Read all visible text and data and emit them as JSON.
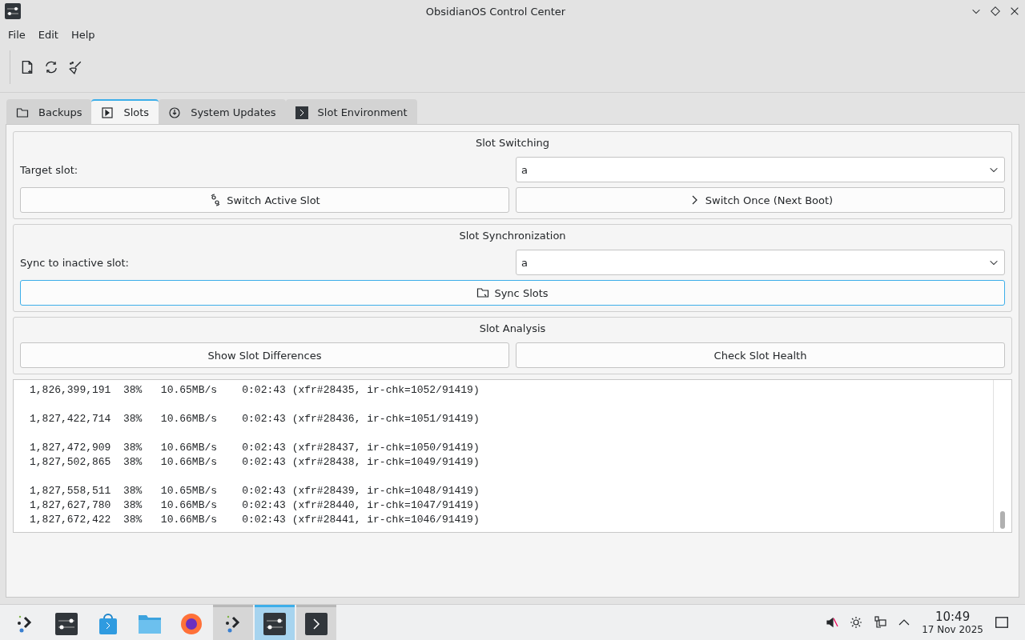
{
  "window": {
    "title": "ObsidianOS Control Center"
  },
  "menu": [
    "File",
    "Edit",
    "Help"
  ],
  "toolbar": [
    {
      "kind": "new"
    },
    {
      "kind": "refresh"
    },
    {
      "kind": "clean"
    }
  ],
  "tabs": [
    {
      "label": "Backups",
      "kind": "folder",
      "selected": false
    },
    {
      "label": "Slots",
      "kind": "play",
      "selected": true
    },
    {
      "label": "System Updates",
      "kind": "update",
      "selected": false
    },
    {
      "label": "Slot Environment",
      "kind": "terminal",
      "selected": false
    }
  ],
  "groups": [
    {
      "title": "Slot Switching",
      "field": {
        "label": "Target slot:",
        "value": "a"
      },
      "buttons": [
        {
          "label": "Switch Active Slot",
          "kind": "swap",
          "focused": false
        },
        {
          "label": "Switch Once (Next Boot)",
          "kind": "chevron",
          "focused": false
        }
      ]
    },
    {
      "title": "Slot Synchronization",
      "field": {
        "label": "Sync to inactive slot:",
        "value": "a"
      },
      "buttons": [
        {
          "label": "Sync Slots",
          "kind": "folder",
          "focused": true
        }
      ]
    },
    {
      "title": "Slot Analysis",
      "buttons": [
        {
          "label": "Show Slot Differences",
          "kind": "plain",
          "focused": false
        },
        {
          "label": "Check Slot Health",
          "kind": "plain",
          "focused": false
        }
      ]
    }
  ],
  "log": [
    {
      "lines": [
        "1,826,399,191  38%   10.65MB/s    0:02:43 (xfr#28435, ir-chk=1052/91419)"
      ]
    },
    {
      "lines": [
        "1,827,422,714  38%   10.66MB/s    0:02:43 (xfr#28436, ir-chk=1051/91419)"
      ]
    },
    {
      "lines": [
        "1,827,472,909  38%   10.66MB/s    0:02:43 (xfr#28437, ir-chk=1050/91419)",
        "1,827,502,865  38%   10.66MB/s    0:02:43 (xfr#28438, ir-chk=1049/91419)"
      ]
    },
    {
      "lines": [
        "1,827,558,511  38%   10.65MB/s    0:02:43 (xfr#28439, ir-chk=1048/91419)",
        "1,827,627,780  38%   10.66MB/s    0:02:43 (xfr#28440, ir-chk=1047/91419)",
        "1,827,672,422  38%   10.66MB/s    0:02:43 (xfr#28441, ir-chk=1046/91419)"
      ]
    }
  ],
  "taskbar": [
    {
      "kind": "launcher",
      "running": false,
      "selected": false
    },
    {
      "kind": "settings",
      "running": false,
      "selected": false
    },
    {
      "kind": "store",
      "running": false,
      "selected": false
    },
    {
      "kind": "files",
      "running": false,
      "selected": false
    },
    {
      "kind": "browser",
      "running": false,
      "selected": false
    },
    {
      "kind": "launcher",
      "running": true,
      "selected": false
    },
    {
      "kind": "settings",
      "running": true,
      "selected": true
    },
    {
      "kind": "terminal",
      "running": true,
      "selected": false
    }
  ],
  "tray": {
    "time": "10:49",
    "date": "17 Nov 2025"
  }
}
